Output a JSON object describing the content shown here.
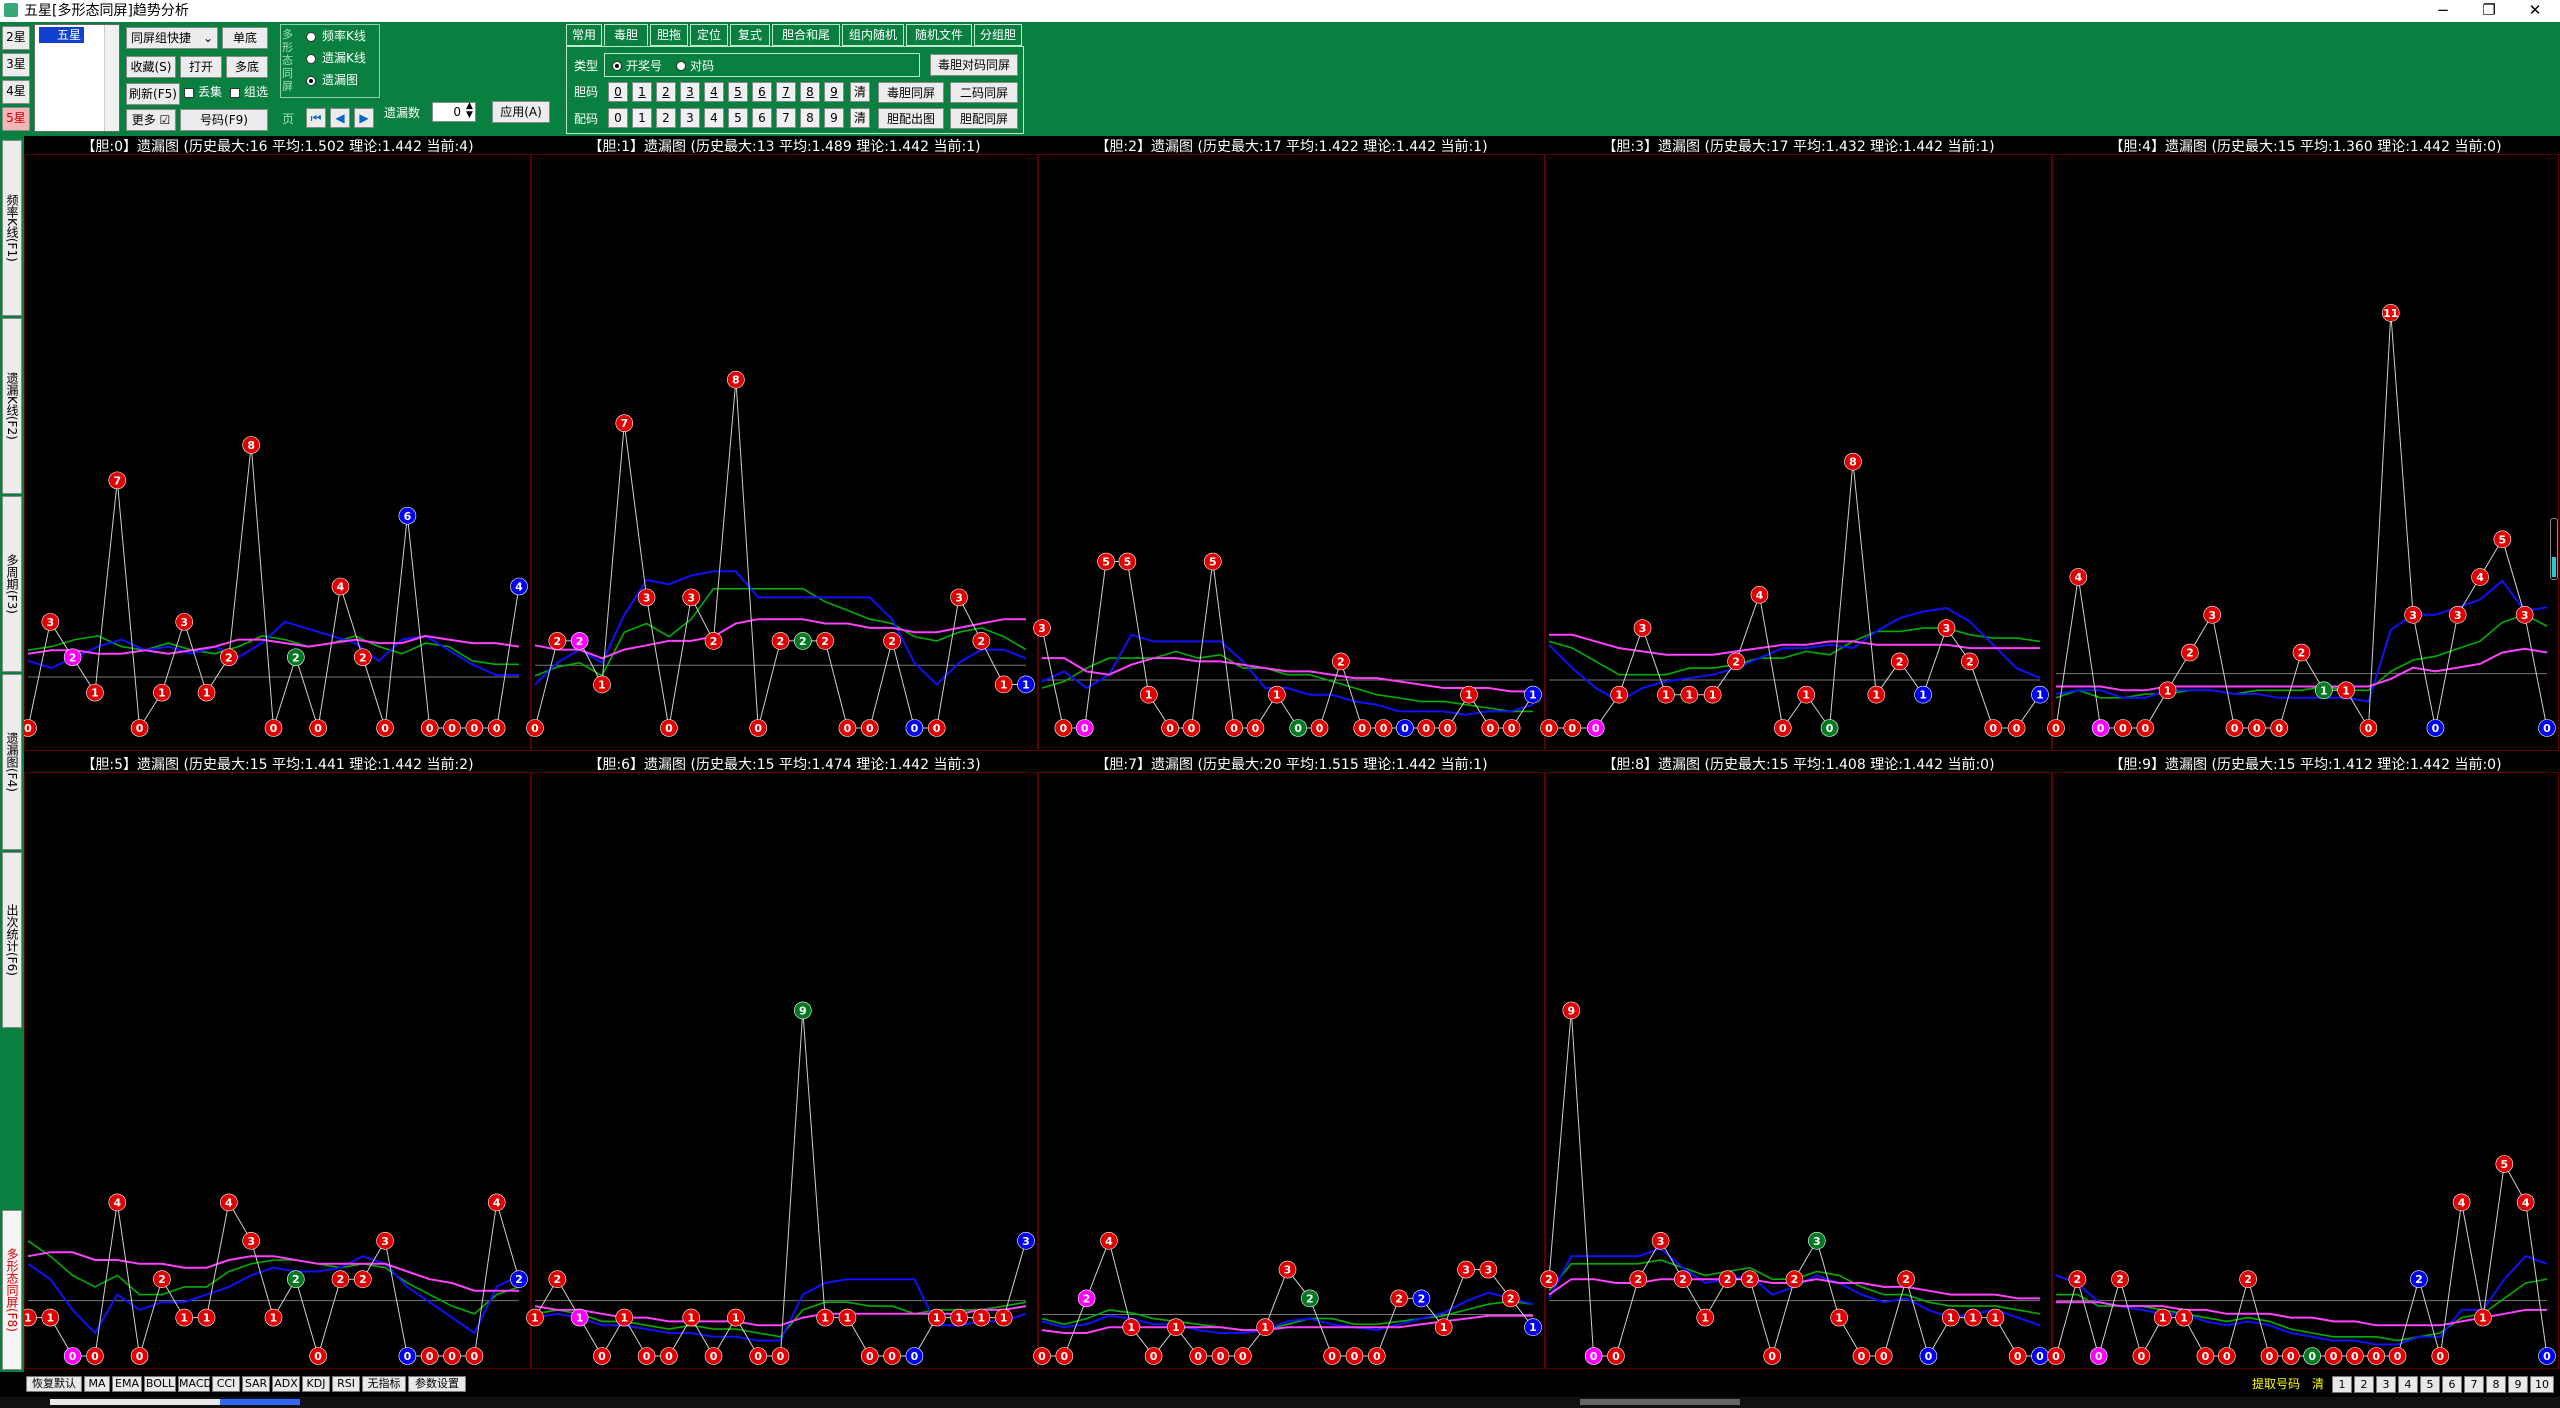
{
  "window": {
    "title": "五星[多形态同屏]趋势分析",
    "minimize": "−",
    "maximize": "❐",
    "close": "✕"
  },
  "star_buttons": [
    "2星",
    "3星",
    "4星",
    "5星"
  ],
  "tree": {
    "node": "五星"
  },
  "left_controls": {
    "combo": "同屏组快捷",
    "single": "单底",
    "favorite": "收藏(S)",
    "open": "打开",
    "multi": "多底",
    "refresh": "刷新(F5)",
    "loss_label": "丢集",
    "combine_label": "组选",
    "more": "更多",
    "number": "号码(F9)"
  },
  "mode_group": {
    "label": "多形态同屏",
    "options": [
      "频率K线",
      "遗漏K线",
      "遗漏图"
    ],
    "selected": 2
  },
  "nav": {
    "side_label": "页",
    "period_label": "遗漏数",
    "period_value": "0",
    "apply": "应用(A)"
  },
  "tabs": [
    "常用",
    "毒胆",
    "胆拖",
    "定位",
    "复式",
    "胆合和尾",
    "组内随机",
    "随机文件",
    "分组胆"
  ],
  "active_tab": 1,
  "tab_panel": {
    "type_label": "类型",
    "type_options": [
      "开奖号",
      "对码"
    ],
    "type_selected": 0,
    "dan_label": "胆码",
    "pei_label": "配码",
    "digits": [
      "0",
      "1",
      "2",
      "3",
      "4",
      "5",
      "6",
      "7",
      "8",
      "9"
    ],
    "clear": "清",
    "btn_dual_code": "毒胆对码同屏",
    "btn_dual": "毒胆同屏",
    "btn_two_code": "二码同屏",
    "btn_out": "胆配出图",
    "btn_pei": "胆配同屏"
  },
  "side_tabs": [
    "频率K线(F1)",
    "遗漏K线(F2)",
    "多周期(F3)",
    "遗漏图(F4)",
    "出次统计(F6)",
    "多形态同屏(F8)"
  ],
  "side_active": 5,
  "status_buttons": [
    "恢复默认",
    "MA",
    "EMA",
    "BOLL",
    "MACD",
    "CCI",
    "SAR",
    "ADX",
    "KDJ",
    "RSI",
    "无指标",
    "参数设置"
  ],
  "status_right": {
    "label": "提取号码",
    "clear": "清",
    "pages": [
      "1",
      "2",
      "3",
      "4",
      "5",
      "6",
      "7",
      "8",
      "9",
      "10"
    ]
  },
  "colors": {
    "toolbar": "#0a8040",
    "red": "#e00000",
    "blue": "#0000f0",
    "green": "#007a20",
    "magenta": "#ff00ff",
    "line_blue": "#1010ff",
    "line_green": "#00b000",
    "line_magenta": "#ff40ff"
  },
  "chart_data": [
    {
      "type": "line",
      "title": "【胆:0】遗漏图 (历史最大:16 平均:1.502 理论:1.442 当前:4)",
      "theory": 1.442,
      "ylim": [
        0,
        16
      ],
      "values": [
        0,
        3,
        2,
        1,
        7,
        0,
        1,
        3,
        1,
        2,
        8,
        0,
        2,
        0,
        4,
        2,
        0,
        6,
        0,
        0,
        0,
        0,
        4
      ],
      "marks": [
        "r",
        "r",
        "m",
        "r",
        "r",
        "r",
        "r",
        "r",
        "r",
        "r",
        "r",
        "r",
        "g",
        "r",
        "r",
        "r",
        "r",
        "b",
        "r",
        "r",
        "r",
        "r",
        "b"
      ],
      "ma_blue": [
        1.9,
        1.7,
        2.0,
        2.3,
        2.5,
        2.2,
        2.3,
        2.1,
        2.3,
        2.0,
        2.4,
        3.0,
        2.8,
        2.6,
        2.4,
        1.9,
        2.5,
        2.6,
        2.2,
        1.8,
        1.5,
        1.5
      ],
      "ma_green": [
        2.2,
        2.3,
        2.5,
        2.6,
        2.3,
        2.2,
        2.4,
        2.2,
        2.1,
        2.3,
        2.6,
        2.5,
        2.3,
        2.4,
        2.6,
        2.3,
        2.1,
        2.4,
        2.3,
        1.9,
        1.8,
        1.8
      ],
      "ma_magenta": [
        2.1,
        2.2,
        2.2,
        2.1,
        2.1,
        2.2,
        2.1,
        2.2,
        2.3,
        2.5,
        2.5,
        2.4,
        2.3,
        2.4,
        2.5,
        2.4,
        2.4,
        2.6,
        2.5,
        2.4,
        2.4,
        2.3
      ]
    },
    {
      "type": "line",
      "title": "【胆:1】遗漏图 (历史最大:13 平均:1.489 理论:1.442 当前:1)",
      "theory": 1.442,
      "ylim": [
        0,
        13
      ],
      "values": [
        0,
        2,
        2,
        1,
        7,
        3,
        0,
        3,
        2,
        8,
        0,
        2,
        2,
        2,
        0,
        0,
        2,
        0,
        0,
        3,
        2,
        1,
        1
      ],
      "marks": [
        "r",
        "r",
        "m",
        "r",
        "r",
        "r",
        "r",
        "r",
        "r",
        "r",
        "r",
        "r",
        "g",
        "r",
        "r",
        "r",
        "r",
        "b",
        "r",
        "r",
        "r",
        "r",
        "b"
      ],
      "ma_blue": [
        1.0,
        1.5,
        1.8,
        1.5,
        2.6,
        3.4,
        3.3,
        3.5,
        3.6,
        3.6,
        3.0,
        3.0,
        3.0,
        3.0,
        3.0,
        3.0,
        2.5,
        1.5,
        1.0,
        1.5,
        1.8,
        1.8,
        1.6
      ],
      "ma_green": [
        1.2,
        1.4,
        1.5,
        1.2,
        2.2,
        2.4,
        2.1,
        2.5,
        3.2,
        3.2,
        3.2,
        3.2,
        3.2,
        2.9,
        2.7,
        2.5,
        2.4,
        2.1,
        2.0,
        2.2,
        2.3,
        2.1,
        1.8
      ],
      "ma_magenta": [
        1.9,
        1.8,
        1.8,
        1.6,
        1.8,
        1.9,
        2.0,
        2.0,
        2.1,
        2.4,
        2.5,
        2.5,
        2.5,
        2.4,
        2.4,
        2.3,
        2.3,
        2.2,
        2.2,
        2.3,
        2.4,
        2.5,
        2.5
      ]
    },
    {
      "type": "line",
      "title": "【胆:2】遗漏图 (历史最大:17 平均:1.422 理论:1.442 当前:1)",
      "theory": 1.442,
      "ylim": [
        0,
        17
      ],
      "values": [
        3,
        0,
        0,
        5,
        5,
        1,
        0,
        0,
        5,
        0,
        0,
        1,
        0,
        0,
        2,
        0,
        0,
        0,
        0,
        0,
        1,
        0,
        0,
        1
      ],
      "marks": [
        "r",
        "r",
        "m",
        "r",
        "r",
        "r",
        "r",
        "r",
        "r",
        "r",
        "r",
        "r",
        "g",
        "r",
        "r",
        "r",
        "r",
        "b",
        "r",
        "r",
        "r",
        "r",
        "r",
        "b"
      ],
      "ma_blue": [
        1.4,
        1.7,
        1.2,
        1.6,
        2.8,
        2.6,
        2.6,
        2.6,
        2.6,
        2.0,
        1.2,
        1.2,
        1.0,
        1.0,
        0.8,
        0.7,
        0.5,
        0.5,
        0.5,
        0.4,
        0.5,
        0.5,
        0.7
      ],
      "ma_green": [
        1.2,
        1.4,
        1.8,
        2.1,
        2.1,
        2.1,
        2.3,
        2.1,
        2.2,
        1.8,
        1.8,
        1.6,
        1.6,
        1.4,
        1.2,
        1.0,
        0.9,
        0.8,
        0.8,
        0.7,
        0.6,
        0.5,
        0.5
      ],
      "ma_magenta": [
        2.1,
        2.1,
        1.7,
        1.6,
        1.9,
        2.1,
        2.1,
        2.0,
        2.0,
        1.9,
        1.8,
        1.7,
        1.7,
        1.6,
        1.5,
        1.5,
        1.4,
        1.3,
        1.2,
        1.2,
        1.2,
        1.1,
        1.1
      ]
    },
    {
      "type": "line",
      "title": "【胆:3】遗漏图 (历史最大:17 平均:1.432 理论:1.442 当前:1)",
      "theory": 1.442,
      "ylim": [
        0,
        17
      ],
      "values": [
        0,
        0,
        0,
        1,
        3,
        1,
        1,
        1,
        2,
        4,
        0,
        1,
        0,
        8,
        1,
        2,
        1,
        3,
        2,
        0,
        0,
        1
      ],
      "marks": [
        "r",
        "r",
        "m",
        "r",
        "r",
        "r",
        "r",
        "r",
        "r",
        "r",
        "r",
        "r",
        "g",
        "r",
        "r",
        "r",
        "b",
        "r",
        "r",
        "r",
        "r",
        "b"
      ],
      "ma_blue": [
        2.5,
        1.8,
        1.2,
        0.8,
        1.2,
        1.4,
        1.5,
        1.6,
        1.8,
        2.1,
        2.4,
        2.4,
        2.5,
        2.4,
        2.9,
        3.3,
        3.5,
        3.6,
        3.2,
        2.5,
        1.8,
        1.5
      ],
      "ma_green": [
        2.6,
        2.4,
        2.0,
        1.6,
        1.6,
        1.6,
        1.8,
        1.8,
        1.9,
        2.1,
        2.1,
        2.3,
        2.2,
        2.6,
        2.9,
        2.9,
        3.0,
        3.0,
        2.8,
        2.7,
        2.7,
        2.6
      ],
      "ma_magenta": [
        2.8,
        2.8,
        2.6,
        2.4,
        2.3,
        2.2,
        2.2,
        2.2,
        2.3,
        2.4,
        2.5,
        2.5,
        2.6,
        2.6,
        2.5,
        2.5,
        2.5,
        2.5,
        2.4,
        2.4,
        2.4,
        2.4
      ]
    },
    {
      "type": "line",
      "title": "【胆:4】遗漏图 (历史最大:15 平均:1.360 理论:1.442 当前:0)",
      "theory": 1.442,
      "ylim": [
        0,
        15
      ],
      "values": [
        0,
        4,
        0,
        0,
        0,
        1,
        2,
        3,
        0,
        0,
        0,
        2,
        1,
        1,
        0,
        11,
        3,
        0,
        3,
        4,
        5,
        3,
        0
      ],
      "marks": [
        "r",
        "r",
        "m",
        "r",
        "r",
        "r",
        "r",
        "r",
        "r",
        "r",
        "r",
        "r",
        "g",
        "r",
        "r",
        "r",
        "r",
        "b",
        "r",
        "r",
        "r",
        "r",
        "b"
      ],
      "ma_blue": [
        0.9,
        1.0,
        1.0,
        0.8,
        0.8,
        1.0,
        1.0,
        1.0,
        0.9,
        0.9,
        0.8,
        0.8,
        0.8,
        0.8,
        0.7,
        2.6,
        3.0,
        3.0,
        3.2,
        3.4,
        3.9,
        3.1,
        3.2
      ],
      "ma_green": [
        0.8,
        1.0,
        0.8,
        0.8,
        0.9,
        0.9,
        1.0,
        1.0,
        0.9,
        1.0,
        1.0,
        1.0,
        1.1,
        1.0,
        1.0,
        1.5,
        1.8,
        1.9,
        2.1,
        2.3,
        2.8,
        3.0,
        2.7
      ],
      "ma_magenta": [
        1.1,
        1.1,
        1.1,
        1.0,
        1.0,
        1.1,
        1.1,
        1.1,
        1.1,
        1.1,
        1.1,
        1.1,
        1.1,
        1.1,
        1.1,
        1.3,
        1.6,
        1.5,
        1.6,
        1.7,
        2.0,
        2.1,
        2.0
      ]
    },
    {
      "type": "line",
      "title": "【胆:5】遗漏图 (历史最大:15 平均:1.441 理论:1.442 当前:2)",
      "theory": 1.442,
      "ylim": [
        0,
        15
      ],
      "values": [
        1,
        1,
        0,
        0,
        4,
        0,
        2,
        1,
        1,
        4,
        3,
        1,
        2,
        0,
        2,
        2,
        3,
        0,
        0,
        0,
        0,
        4,
        2
      ],
      "marks": [
        "r",
        "r",
        "m",
        "r",
        "r",
        "r",
        "r",
        "r",
        "r",
        "r",
        "r",
        "r",
        "g",
        "r",
        "r",
        "r",
        "r",
        "b",
        "r",
        "r",
        "r",
        "r",
        "b"
      ],
      "ma_blue": [
        2.4,
        2.0,
        1.2,
        0.6,
        1.6,
        1.2,
        1.4,
        1.4,
        1.6,
        1.8,
        2.1,
        2.3,
        2.2,
        2.2,
        2.3,
        2.6,
        2.4,
        1.8,
        1.4,
        1.0,
        0.6,
        1.8,
        2.1
      ],
      "ma_green": [
        3.0,
        2.6,
        2.1,
        1.8,
        2.1,
        1.6,
        1.6,
        1.8,
        1.8,
        2.2,
        2.4,
        2.5,
        2.5,
        2.4,
        2.3,
        2.4,
        2.3,
        1.9,
        1.6,
        1.3,
        1.1,
        1.6,
        1.8
      ],
      "ma_magenta": [
        2.6,
        2.7,
        2.7,
        2.5,
        2.5,
        2.4,
        2.4,
        2.3,
        2.3,
        2.5,
        2.6,
        2.6,
        2.5,
        2.4,
        2.4,
        2.4,
        2.4,
        2.2,
        2.0,
        1.9,
        1.7,
        1.7,
        1.7
      ]
    },
    {
      "type": "line",
      "title": "【胆:6】遗漏图 (历史最大:15 平均:1.474 理论:1.442 当前:3)",
      "theory": 1.442,
      "ylim": [
        0,
        15
      ],
      "values": [
        1,
        2,
        1,
        0,
        1,
        0,
        0,
        1,
        0,
        1,
        0,
        0,
        9,
        1,
        1,
        0,
        0,
        0,
        1,
        1,
        1,
        1,
        3
      ],
      "marks": [
        "r",
        "r",
        "m",
        "r",
        "r",
        "r",
        "r",
        "r",
        "r",
        "r",
        "r",
        "r",
        "g",
        "r",
        "r",
        "r",
        "r",
        "b",
        "r",
        "r",
        "r",
        "r",
        "b"
      ],
      "ma_blue": [
        1.0,
        1.1,
        1.0,
        0.8,
        0.8,
        0.7,
        0.6,
        0.6,
        0.5,
        0.5,
        0.4,
        0.4,
        1.6,
        1.9,
        2.0,
        2.0,
        2.0,
        2.0,
        0.8,
        0.8,
        0.9,
        0.9,
        1.1
      ],
      "ma_green": [
        1.1,
        1.2,
        1.1,
        0.9,
        0.9,
        0.8,
        0.7,
        0.8,
        0.7,
        0.7,
        0.6,
        0.5,
        1.2,
        1.4,
        1.4,
        1.3,
        1.3,
        1.1,
        1.2,
        1.2,
        1.2,
        1.3,
        1.4
      ],
      "ma_magenta": [
        1.3,
        1.2,
        1.2,
        1.1,
        1.0,
        1.0,
        0.9,
        0.9,
        0.9,
        0.9,
        0.8,
        0.8,
        1.0,
        1.1,
        1.1,
        1.1,
        1.1,
        1.1,
        1.1,
        1.1,
        1.2,
        1.2,
        1.3
      ]
    },
    {
      "type": "line",
      "title": "【胆:7】遗漏图 (历史最大:20 平均:1.515 理论:1.442 当前:1)",
      "theory": 1.442,
      "ylim": [
        0,
        20
      ],
      "values": [
        0,
        0,
        2,
        4,
        1,
        0,
        1,
        0,
        0,
        0,
        1,
        3,
        2,
        0,
        0,
        0,
        2,
        2,
        1,
        3,
        3,
        2,
        1
      ],
      "marks": [
        "r",
        "r",
        "m",
        "r",
        "r",
        "r",
        "r",
        "r",
        "r",
        "r",
        "r",
        "r",
        "g",
        "r",
        "r",
        "r",
        "r",
        "b",
        "r",
        "r",
        "r",
        "r",
        "b"
      ],
      "ma_blue": [
        1.2,
        1.0,
        1.1,
        1.4,
        1.3,
        1.1,
        1.1,
        0.9,
        0.8,
        0.8,
        0.9,
        1.2,
        1.3,
        1.1,
        1.0,
        0.9,
        1.1,
        1.3,
        1.5,
        1.9,
        2.2,
        2.0,
        1.8
      ],
      "ma_green": [
        1.3,
        1.1,
        1.3,
        1.6,
        1.5,
        1.3,
        1.2,
        1.1,
        1.0,
        0.9,
        0.9,
        1.1,
        1.3,
        1.3,
        1.1,
        1.1,
        1.2,
        1.3,
        1.4,
        1.6,
        1.8,
        1.9,
        1.8
      ],
      "ma_magenta": [
        0.9,
        0.8,
        0.8,
        1.0,
        1.0,
        1.0,
        1.0,
        1.0,
        1.0,
        0.9,
        0.9,
        1.0,
        1.0,
        1.0,
        1.0,
        1.0,
        1.0,
        1.1,
        1.2,
        1.3,
        1.4,
        1.4,
        1.4
      ]
    },
    {
      "type": "line",
      "title": "【胆:8】遗漏图 (历史最大:15 平均:1.408 理论:1.442 当前:0)",
      "theory": 1.442,
      "ylim": [
        0,
        15
      ],
      "values": [
        2,
        9,
        0,
        0,
        2,
        3,
        2,
        1,
        2,
        2,
        0,
        2,
        3,
        1,
        0,
        0,
        2,
        0,
        1,
        1,
        1,
        0,
        0
      ],
      "marks": [
        "r",
        "r",
        "m",
        "r",
        "r",
        "r",
        "r",
        "r",
        "r",
        "r",
        "r",
        "r",
        "g",
        "r",
        "r",
        "r",
        "r",
        "b",
        "r",
        "r",
        "r",
        "r",
        "b"
      ],
      "ma_blue": [
        1.5,
        2.6,
        2.6,
        2.6,
        2.6,
        2.8,
        2.3,
        1.9,
        2.0,
        2.1,
        1.6,
        1.8,
        2.1,
        1.9,
        1.6,
        1.4,
        1.5,
        1.2,
        1.0,
        1.1,
        1.2,
        1.0,
        0.8
      ],
      "ma_green": [
        1.7,
        2.4,
        2.4,
        2.4,
        2.4,
        2.5,
        2.3,
        2.1,
        2.2,
        2.3,
        2.0,
        2.0,
        2.2,
        2.1,
        1.8,
        1.6,
        1.6,
        1.4,
        1.3,
        1.3,
        1.3,
        1.2,
        1.1
      ],
      "ma_magenta": [
        1.6,
        2.0,
        2.0,
        1.9,
        1.9,
        2.0,
        2.0,
        2.0,
        2.0,
        2.0,
        1.9,
        1.9,
        2.0,
        1.9,
        1.9,
        1.8,
        1.8,
        1.7,
        1.6,
        1.6,
        1.6,
        1.5,
        1.5
      ]
    },
    {
      "type": "line",
      "title": "【胆:9】遗漏图 (历史最大:15 平均:1.412 理论:1.442 当前:0)",
      "theory": 1.442,
      "ylim": [
        0,
        15
      ],
      "values": [
        0,
        2,
        0,
        2,
        0,
        1,
        1,
        0,
        0,
        2,
        0,
        0,
        0,
        0,
        0,
        0,
        0,
        2,
        0,
        4,
        1,
        5,
        4,
        0
      ],
      "marks": [
        "r",
        "r",
        "m",
        "r",
        "r",
        "r",
        "r",
        "r",
        "r",
        "r",
        "r",
        "r",
        "g",
        "r",
        "r",
        "r",
        "r",
        "b",
        "r",
        "r",
        "r",
        "r",
        "r",
        "b"
      ],
      "ma_blue": [
        2.1,
        1.9,
        1.4,
        1.3,
        1.2,
        1.1,
        1.1,
        0.9,
        0.8,
        0.9,
        0.8,
        0.6,
        0.5,
        0.4,
        0.4,
        0.3,
        0.3,
        0.5,
        0.5,
        1.2,
        1.2,
        2.0,
        2.6,
        2.4
      ],
      "ma_green": [
        1.6,
        1.6,
        1.3,
        1.3,
        1.3,
        1.2,
        1.1,
        1.0,
        0.9,
        1.0,
        0.9,
        0.7,
        0.6,
        0.5,
        0.5,
        0.5,
        0.4,
        0.5,
        0.6,
        1.0,
        1.1,
        1.5,
        1.9,
        2.0
      ],
      "ma_magenta": [
        1.4,
        1.4,
        1.4,
        1.3,
        1.3,
        1.3,
        1.2,
        1.2,
        1.1,
        1.1,
        1.1,
        1.0,
        1.0,
        0.9,
        0.9,
        0.8,
        0.8,
        0.8,
        0.8,
        0.9,
        1.0,
        1.1,
        1.2,
        1.2
      ]
    }
  ]
}
